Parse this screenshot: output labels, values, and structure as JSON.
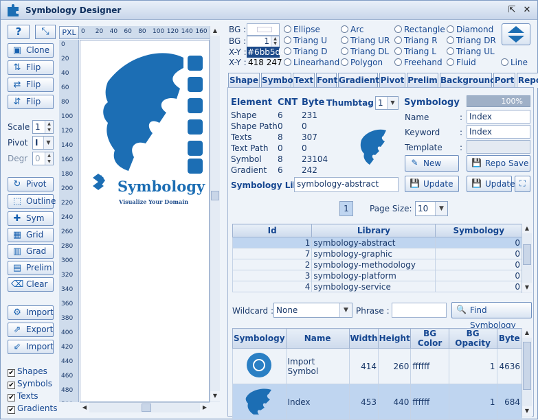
{
  "window": {
    "title": "Symbology Designer"
  },
  "toolbar": {
    "help_label": "?",
    "clone": "Clone",
    "flip1": "Flip",
    "flip2": "Flip",
    "flip3": "Flip",
    "scale_label": "Scale",
    "scale_value": "1",
    "pivot_label": "Pivot",
    "pivot_value": "I",
    "degr_label": "Degr",
    "degr_value": "0",
    "pivot_btn": "Pivot",
    "outline": "Outline",
    "sym": "Sym",
    "grid": "Grid",
    "grad": "Grad",
    "prelim": "Prelim",
    "clear": "Clear",
    "import1": "Import",
    "export": "Export",
    "import2": "Import"
  },
  "checks": {
    "shapes": "Shapes",
    "symbols": "Symbols",
    "texts": "Texts",
    "gradients": "Gradients"
  },
  "ruler": {
    "unit": "PXL",
    "top": [
      "0",
      "20",
      "40",
      "60",
      "80",
      "100",
      "120",
      "140",
      "160"
    ],
    "left": [
      "0",
      "20",
      "40",
      "60",
      "80",
      "100",
      "120",
      "140",
      "160",
      "180",
      "200",
      "220",
      "240",
      "260",
      "280",
      "300",
      "320",
      "340",
      "360",
      "380",
      "400",
      "420",
      "440",
      "460",
      "480",
      "500"
    ]
  },
  "canvas": {
    "brand": "Symbology",
    "tagline": "Visualize Your Domain"
  },
  "props": {
    "bg1_label": "BG :",
    "bg2_label": "BG :",
    "bg2_value": "1",
    "xy1_label": "X-Y :",
    "xy1_value": "#6bb5d4",
    "xy2_label": "X-Y :",
    "xy2_value": "418 247"
  },
  "shapes_radio": [
    "Ellipse",
    "Arc",
    "Rectangle",
    "Diamond",
    "Triang U",
    "Triang UR",
    "Triang R",
    "Triang DR",
    "Triang D",
    "Triang DL",
    "Triang L",
    "Triang UL",
    "Linearhand",
    "Polygon",
    "Freehand",
    "Fluid",
    "Line"
  ],
  "tabs": [
    "Shape",
    "Symbol",
    "Text",
    "Font",
    "Gradient",
    "Pivot",
    "Prelim",
    "Background",
    "Port",
    "Repo"
  ],
  "stats": {
    "element_h": "Element",
    "cnt_h": "CNT",
    "byte_h": "Byte",
    "thumbtag_label": "Thumbtag :",
    "thumbtag_value": "1",
    "rows": [
      {
        "name": "Shape",
        "cnt": "6",
        "byte": "231"
      },
      {
        "name": "Shape Path",
        "cnt": "0",
        "byte": "0"
      },
      {
        "name": "Texts",
        "cnt": "8",
        "byte": "307"
      },
      {
        "name": "Text Path",
        "cnt": "0",
        "byte": "0"
      },
      {
        "name": "Symbol",
        "cnt": "8",
        "byte": "23104"
      },
      {
        "name": "Gradient",
        "cnt": "6",
        "byte": "242"
      }
    ],
    "lib_label": "Symbology Lib :",
    "lib_value": "symbology-abstract"
  },
  "symbology": {
    "heading": "Symbology",
    "progress": "100%",
    "name_label": "Name",
    "name_value": "Index",
    "keyword_label": "Keyword",
    "keyword_value": "Index",
    "template_label": "Template",
    "colon": ":",
    "new_btn": "New",
    "repo_save": "Repo Save",
    "update1": "Update",
    "update2": "Update"
  },
  "paging": {
    "page": "1",
    "size_label": "Page Size:",
    "size_value": "10"
  },
  "libtable": {
    "headers": [
      "Id",
      "Library",
      "Symbology"
    ],
    "rows": [
      [
        "1",
        "symbology-abstract",
        "0"
      ],
      [
        "7",
        "symbology-graphic",
        "0"
      ],
      [
        "2",
        "symbology-methodology",
        "0"
      ],
      [
        "3",
        "symbology-platform",
        "0"
      ],
      [
        "4",
        "symbology-service",
        "0"
      ]
    ]
  },
  "search": {
    "wildcard_label": "Wildcard :",
    "wildcard_value": "None",
    "phrase_label": "Phrase :",
    "phrase_value": "",
    "find_btn": "Find Symbology"
  },
  "symtable": {
    "headers": [
      "Symbology",
      "Name",
      "Width",
      "Height",
      "BG Color",
      "BG Opacity",
      "Byte"
    ],
    "rows": [
      [
        "",
        "Import Symbol",
        "414",
        "260",
        "ffffff",
        "1",
        "4636"
      ],
      [
        "",
        "Index",
        "453",
        "440",
        "ffffff",
        "1",
        "684"
      ]
    ]
  },
  "colors": {
    "accent": "#1c6eb4",
    "bg": "#eef3f9",
    "selected": "#bfd5f0"
  }
}
